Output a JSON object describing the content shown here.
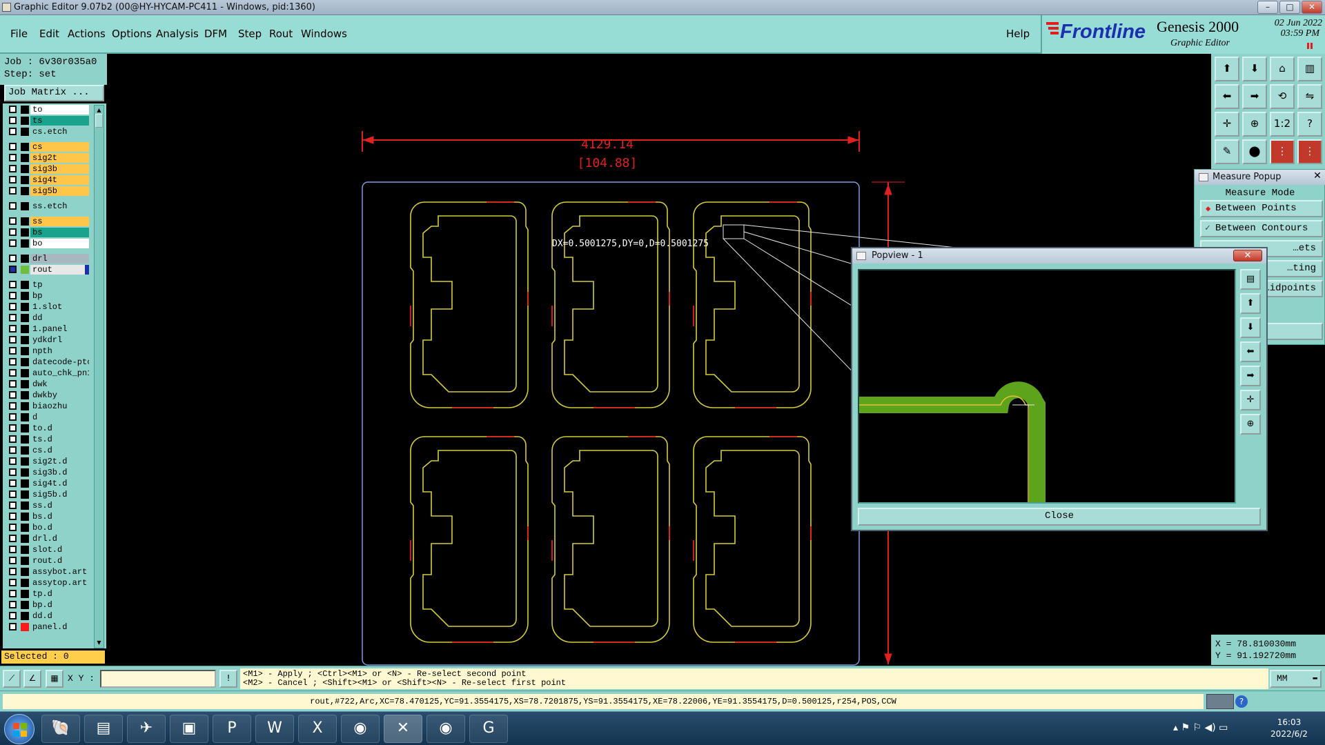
{
  "window": {
    "title": "Graphic Editor 9.07b2 (00@HY-HYCAM-PC411 - Windows, pid:1360)",
    "min_label": "–",
    "max_label": "□",
    "close_label": "✕"
  },
  "menu": {
    "items": [
      "File",
      "Edit",
      "Actions",
      "Options",
      "Analysis",
      "DFM",
      "Step",
      "Rout",
      "Windows"
    ],
    "help": "Help"
  },
  "brand": {
    "logo": "Frontline",
    "product": "Genesis 2000",
    "subtitle": "Graphic Editor",
    "date": "02 Jun 2022",
    "time": "03:59 PM"
  },
  "job": {
    "job_line": "Job : 6v30r035a0",
    "step_line": "Step: set",
    "matrix_button": "Job Matrix ..."
  },
  "layers": [
    {
      "name": "to",
      "color": "#ffffff",
      "swatch": "#000000"
    },
    {
      "name": "ts",
      "color": "#1aa38c",
      "swatch": "#000000"
    },
    {
      "name": "cs.etch",
      "color": "#8fd2ca",
      "swatch": "#000000"
    },
    {
      "name": "cs",
      "color": "#ffc64a",
      "swatch": "#000000"
    },
    {
      "name": "sig2t",
      "color": "#ffc64a",
      "swatch": "#000000"
    },
    {
      "name": "sig3b",
      "color": "#ffc64a",
      "swatch": "#000000"
    },
    {
      "name": "sig4t",
      "color": "#ffc64a",
      "swatch": "#000000"
    },
    {
      "name": "sig5b",
      "color": "#ffc64a",
      "swatch": "#000000"
    },
    {
      "name": "ss.etch",
      "color": "#8fd2ca",
      "swatch": "#000000"
    },
    {
      "name": "ss",
      "color": "#ffc64a",
      "swatch": "#000000"
    },
    {
      "name": "bs",
      "color": "#1aa38c",
      "swatch": "#000000"
    },
    {
      "name": "bo",
      "color": "#ffffff",
      "swatch": "#000000"
    },
    {
      "name": "drl",
      "color": "#a8b8c0",
      "swatch": "#000000"
    },
    {
      "name": "rout",
      "color": "#e8e8e8",
      "swatch": "#6fbf3c",
      "active": true
    },
    {
      "name": "tp",
      "color": "#8fd2ca",
      "swatch": "#000000"
    },
    {
      "name": "bp",
      "color": "#8fd2ca",
      "swatch": "#000000"
    },
    {
      "name": "1.slot",
      "color": "#8fd2ca",
      "swatch": "#000000"
    },
    {
      "name": "dd",
      "color": "#8fd2ca",
      "swatch": "#000000"
    },
    {
      "name": "1.panel",
      "color": "#8fd2ca",
      "swatch": "#000000"
    },
    {
      "name": "ydkdrl",
      "color": "#8fd2ca",
      "swatch": "#000000"
    },
    {
      "name": "npth",
      "color": "#8fd2ca",
      "swatch": "#000000"
    },
    {
      "name": "datecode-pto",
      "color": "#8fd2ca",
      "swatch": "#000000"
    },
    {
      "name": "auto_chk_pn1",
      "color": "#8fd2ca",
      "swatch": "#000000"
    },
    {
      "name": "dwk",
      "color": "#8fd2ca",
      "swatch": "#000000"
    },
    {
      "name": "dwkby",
      "color": "#8fd2ca",
      "swatch": "#000000"
    },
    {
      "name": "biaozhu",
      "color": "#8fd2ca",
      "swatch": "#000000"
    },
    {
      "name": "d",
      "color": "#8fd2ca",
      "swatch": "#000000"
    },
    {
      "name": "to.d",
      "color": "#8fd2ca",
      "swatch": "#000000"
    },
    {
      "name": "ts.d",
      "color": "#8fd2ca",
      "swatch": "#000000"
    },
    {
      "name": "cs.d",
      "color": "#8fd2ca",
      "swatch": "#000000"
    },
    {
      "name": "sig2t.d",
      "color": "#8fd2ca",
      "swatch": "#000000"
    },
    {
      "name": "sig3b.d",
      "color": "#8fd2ca",
      "swatch": "#000000"
    },
    {
      "name": "sig4t.d",
      "color": "#8fd2ca",
      "swatch": "#000000"
    },
    {
      "name": "sig5b.d",
      "color": "#8fd2ca",
      "swatch": "#000000"
    },
    {
      "name": "ss.d",
      "color": "#8fd2ca",
      "swatch": "#000000"
    },
    {
      "name": "bs.d",
      "color": "#8fd2ca",
      "swatch": "#000000"
    },
    {
      "name": "bo.d",
      "color": "#8fd2ca",
      "swatch": "#000000"
    },
    {
      "name": "drl.d",
      "color": "#8fd2ca",
      "swatch": "#000000"
    },
    {
      "name": "slot.d",
      "color": "#8fd2ca",
      "swatch": "#000000"
    },
    {
      "name": "rout.d",
      "color": "#8fd2ca",
      "swatch": "#000000"
    },
    {
      "name": "assybot.art",
      "color": "#8fd2ca",
      "swatch": "#000000"
    },
    {
      "name": "assytop.art",
      "color": "#8fd2ca",
      "swatch": "#000000"
    },
    {
      "name": "tp.d",
      "color": "#8fd2ca",
      "swatch": "#000000"
    },
    {
      "name": "bp.d",
      "color": "#8fd2ca",
      "swatch": "#000000"
    },
    {
      "name": "dd.d",
      "color": "#8fd2ca",
      "swatch": "#000000"
    },
    {
      "name": "panel.d",
      "color": "#8fd2ca",
      "swatch": "#ff1a1a"
    }
  ],
  "selected": "Selected : 0",
  "drawing": {
    "dim_value": "4129.14",
    "dim_secondary": "[104.88]",
    "measure_text": "DX=0.5001275,DY=0,D=0.5001275"
  },
  "measure_popup": {
    "title": "Measure Popup",
    "mode_label": "Measure Mode",
    "options": [
      "Between Points",
      "Between Contours",
      "…ets",
      "…ting",
      "…idpoints",
      "…e"
    ]
  },
  "popview": {
    "title": "Popview - 1",
    "close_button": "Close"
  },
  "coords": {
    "x": "X = 78.810030mm",
    "y": "Y = 91.192720mm"
  },
  "bottom": {
    "xy_label": "X Y :",
    "xy_value": "",
    "hint1": "<M1> - Apply  ; <Ctrl><M1> or <N> - Re-select second point",
    "hint2": "<M2> - Cancel ; <Shift><M1> or <Shift><N> - Re-select first point",
    "unit": "MM"
  },
  "status": "rout,#722,Arc,XC=78.470125,YC=91.3554175,XS=78.7201875,YS=91.3554175,XE=78.22006,YE=91.3554175,D=0.500125,r254,POS,CCW",
  "taskbar": {
    "time": "16:03",
    "date": "2022/6/2"
  }
}
